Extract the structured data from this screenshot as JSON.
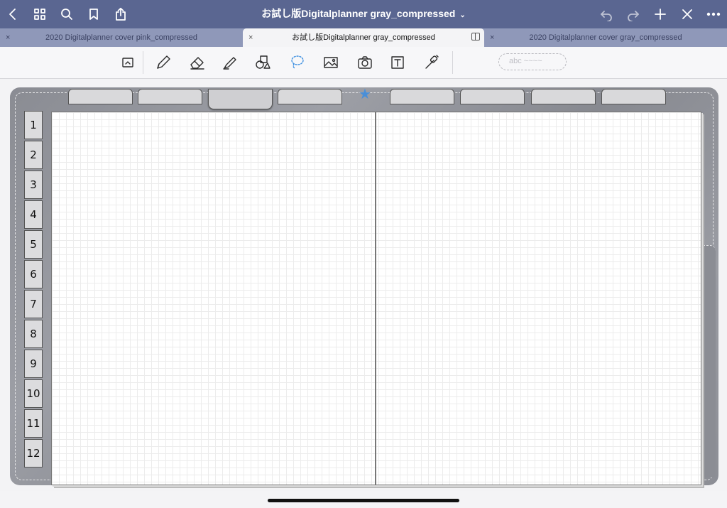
{
  "navbar": {
    "title": "お試し版Digitalplanner gray_compressed",
    "title_chevron": "⌄",
    "left_icons": [
      "back-icon",
      "grid-icon",
      "search-icon",
      "bookmark-icon",
      "share-icon"
    ],
    "right_icons": [
      "undo-icon",
      "redo-icon",
      "plus-icon",
      "close-icon",
      "more-icon"
    ]
  },
  "tabs": [
    {
      "label": "2020 Digitalplanner cover pink_compressed",
      "close": "×"
    },
    {
      "label": "お試し版Digitalplanner gray_compressed",
      "close": "×"
    },
    {
      "label": "2020 Digitalplanner cover gray_compressed",
      "close": "×"
    }
  ],
  "toolbar": {
    "tools": [
      "read-mode-icon",
      "pen-icon",
      "eraser-icon",
      "highlighter-icon",
      "shapes-icon",
      "lasso-icon",
      "image-icon",
      "camera-icon",
      "text-icon",
      "laser-pointer-icon"
    ],
    "selected_tool": "lasso-icon",
    "handwriting_placeholder": "abc ~~~~"
  },
  "planner": {
    "month_tabs": [
      "1",
      "2",
      "3",
      "4",
      "5",
      "6",
      "7",
      "8",
      "9",
      "10",
      "11",
      "12"
    ],
    "top_tab_count": 8,
    "active_top_tab": 3,
    "star": "★",
    "colors": {
      "cover": "#8f9198",
      "accent_star": "#4a8fd8",
      "grid": "#ececec"
    }
  }
}
